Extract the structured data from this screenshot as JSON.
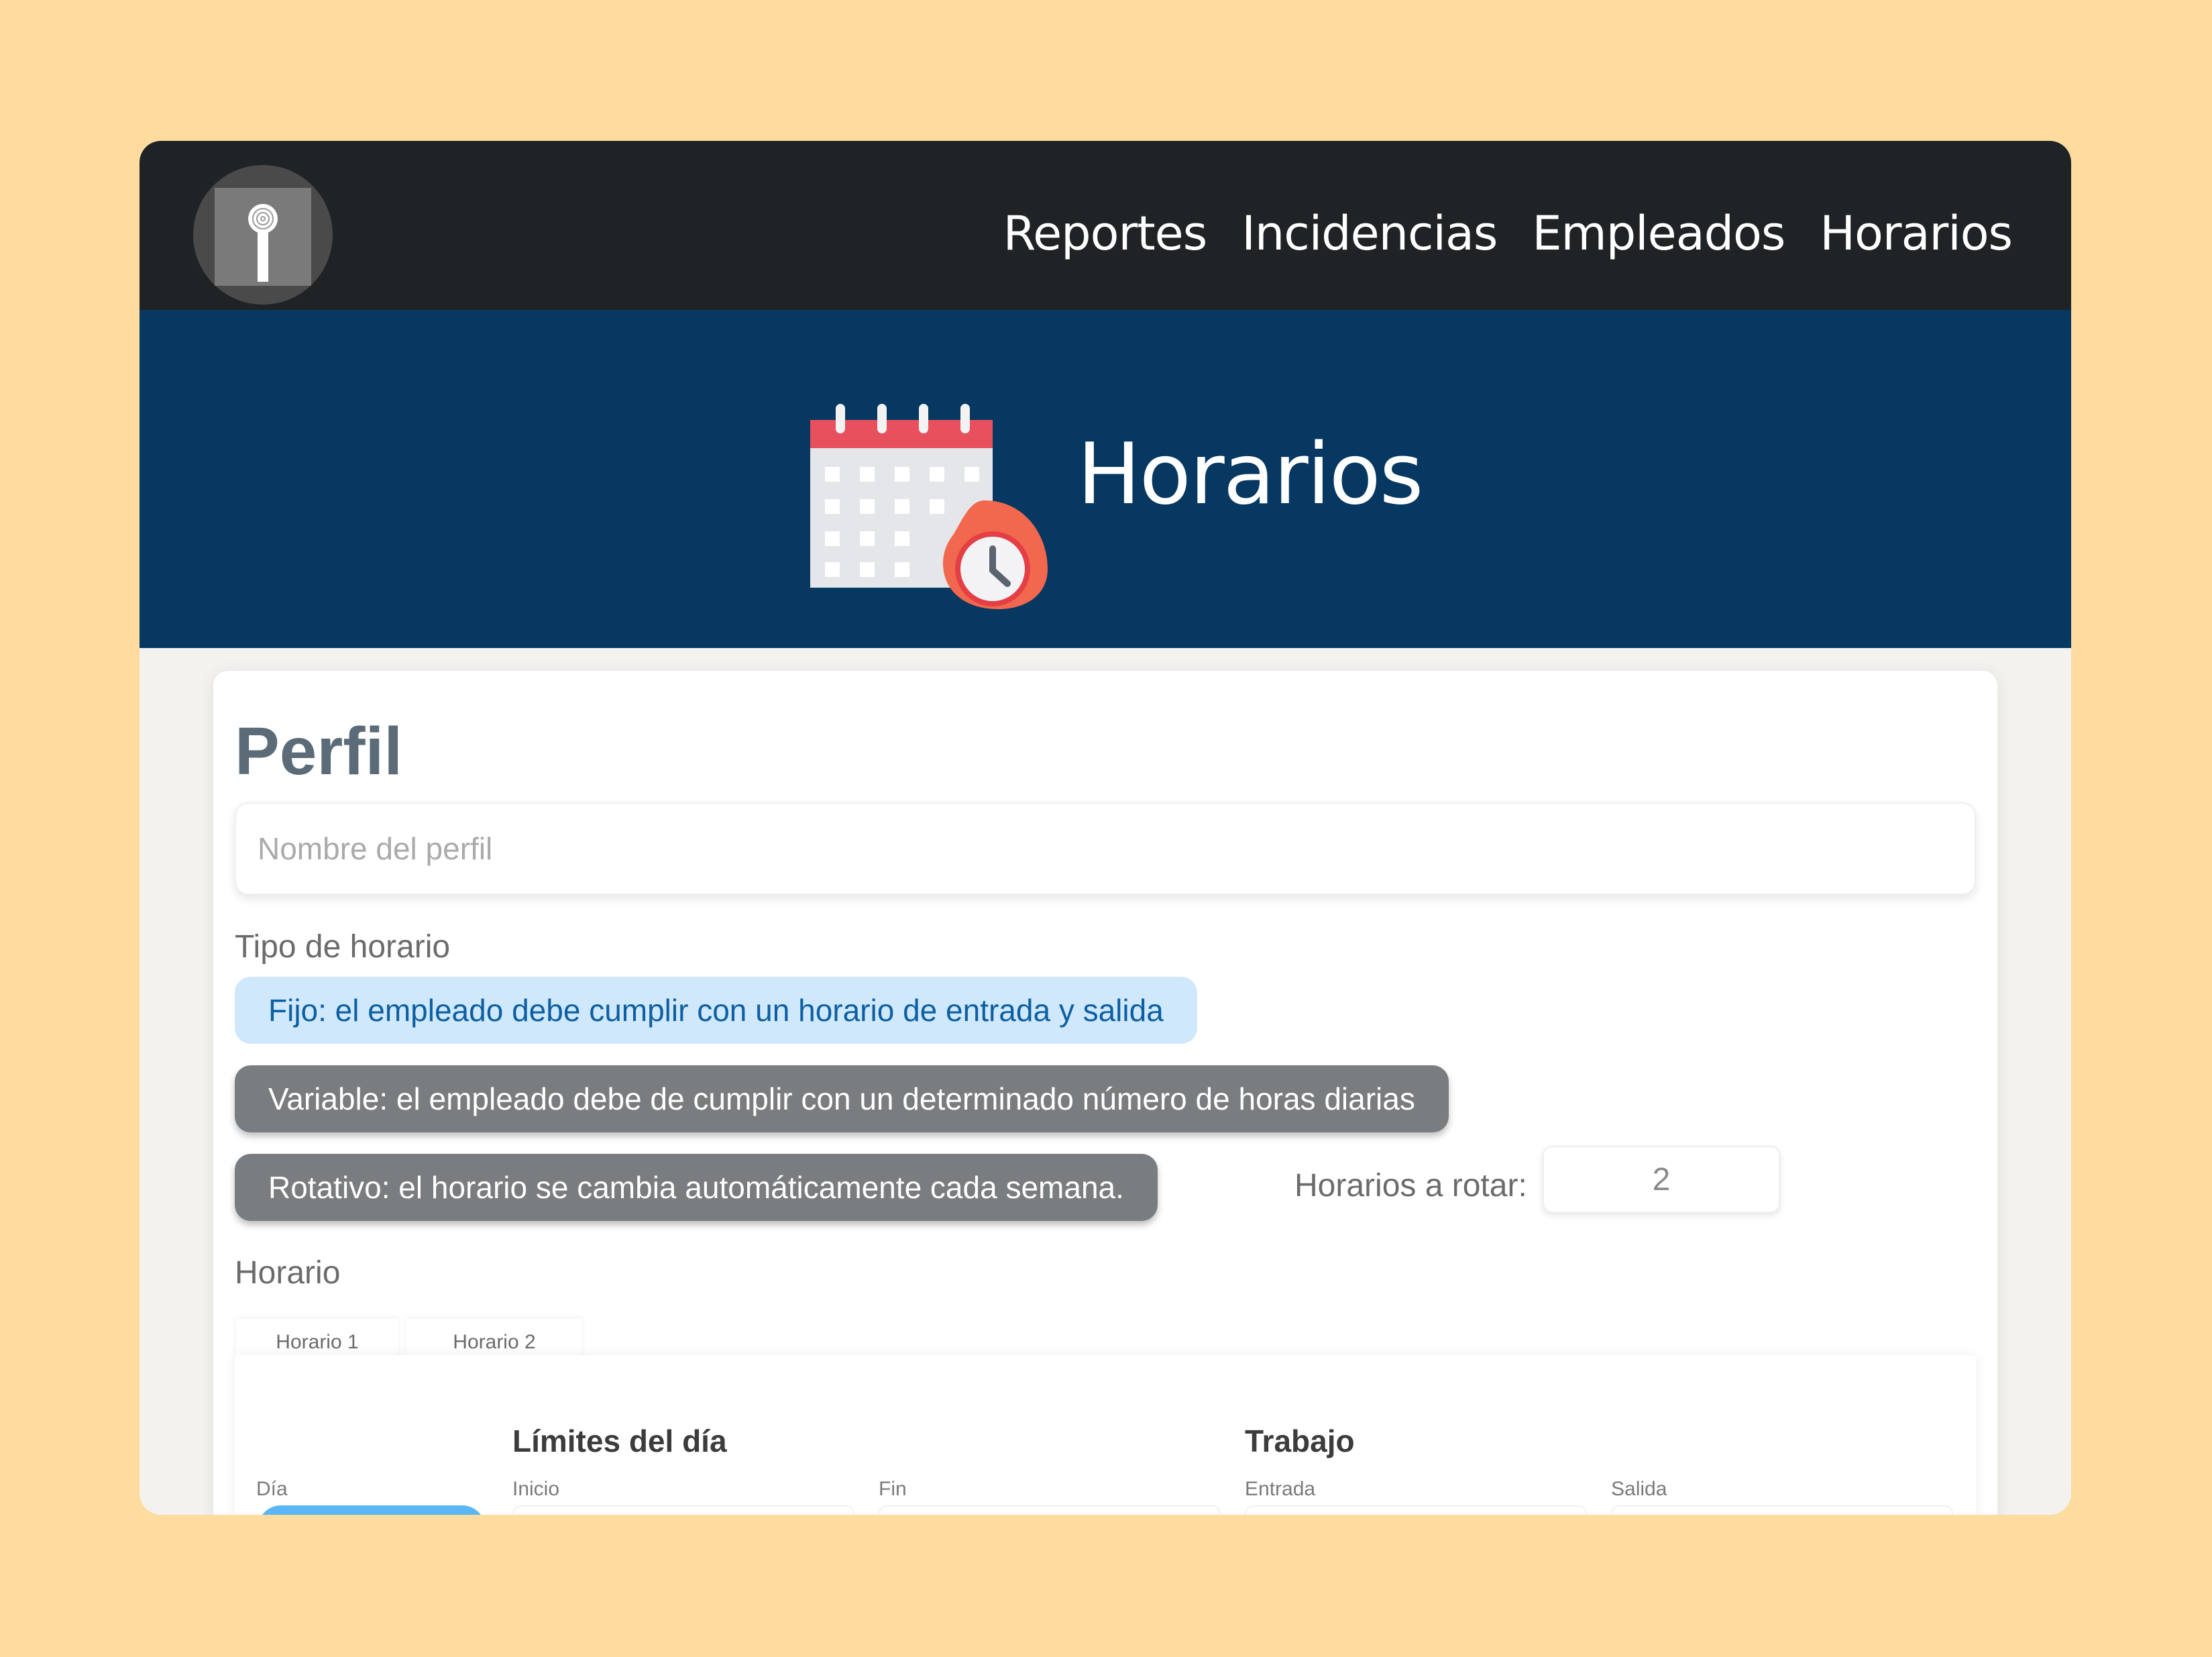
{
  "nav": {
    "links": [
      "Reportes",
      "Incidencias",
      "Empleados",
      "Horarios"
    ],
    "bg_color": "#1F2326"
  },
  "hero": {
    "title": "Horarios",
    "icon": "calendar-clock-icon",
    "bg_color": "#073861"
  },
  "profile": {
    "title": "Perfil",
    "name_placeholder": "Nombre del perfil",
    "name_value": ""
  },
  "schedule_type": {
    "label": "Tipo de horario",
    "options": [
      {
        "label": "Fijo: el empleado debe cumplir con un horario de entrada y salida",
        "selected": true
      },
      {
        "label": "Variable: el empleado debe de cumplir con un determinado número de horas diarias",
        "selected": false
      },
      {
        "label": "Rotativo: el horario se cambia automáticamente cada semana.",
        "selected": false
      }
    ],
    "rotate_label": "Horarios a rotar:",
    "rotate_value": "2"
  },
  "horario": {
    "label": "Horario",
    "tabs": [
      "Horario 1",
      "Horario 2"
    ],
    "groups": [
      "Límites del día",
      "Trabajo"
    ],
    "columns": [
      "Día",
      "Inicio",
      "Fin",
      "Entrada",
      "Salida"
    ]
  },
  "colors": {
    "selected_bg": "#CFE8FB",
    "selected_text": "#0D5FA2",
    "unselected_bg": "#7A7D80",
    "page_bg": "#FEDB9E"
  }
}
